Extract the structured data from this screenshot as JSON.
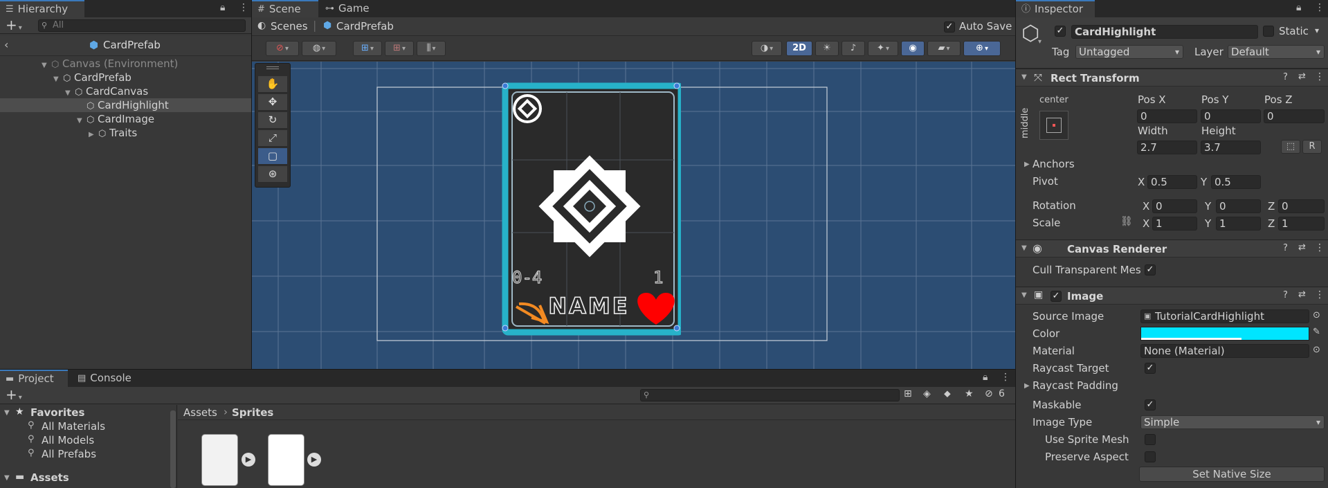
{
  "hierarchy": {
    "tab_label": "Hierarchy",
    "search_placeholder": "All",
    "prefab_title": "CardPrefab",
    "tree": [
      {
        "label": "Canvas (Environment)",
        "depth": 0,
        "expanded": true,
        "muted": true
      },
      {
        "label": "CardPrefab",
        "depth": 1,
        "expanded": true,
        "muted": false
      },
      {
        "label": "CardCanvas",
        "depth": 2,
        "expanded": true,
        "muted": false
      },
      {
        "label": "CardHighlight",
        "depth": 3,
        "expanded": null,
        "muted": false,
        "selected": true
      },
      {
        "label": "CardImage",
        "depth": 3,
        "expanded": true,
        "muted": false
      },
      {
        "label": "Traits",
        "depth": 4,
        "expanded": false,
        "muted": false
      }
    ]
  },
  "scene": {
    "tabs": [
      "Scene",
      "Game"
    ],
    "breadcrumb": [
      "Scenes",
      "CardPrefab"
    ],
    "auto_save_label": "Auto Save",
    "auto_save_checked": true,
    "mode_2d_label": "2D",
    "card": {
      "cost_text": "0-4",
      "power_text": "1",
      "name_text": "NAME"
    },
    "colors": {
      "background": "#2c4d73",
      "highlight": "#27b2c9",
      "card_body": "#2a2a2a",
      "heart": "#ff0000",
      "bow": "#f28a22"
    }
  },
  "inspector": {
    "tab_label": "Inspector",
    "object_name": "CardHighlight",
    "active_checked": true,
    "static_label": "Static",
    "tag_label": "Tag",
    "tag_value": "Untagged",
    "layer_label": "Layer",
    "layer_value": "Default",
    "rect_transform": {
      "title": "Rect Transform",
      "anchor_h": "center",
      "anchor_v": "middle",
      "pos_x_label": "Pos X",
      "pos_x": "0",
      "pos_y_label": "Pos Y",
      "pos_y": "0",
      "pos_z_label": "Pos Z",
      "pos_z": "0",
      "width_label": "Width",
      "width": "2.7",
      "height_label": "Height",
      "height": "3.7",
      "r_button": "R",
      "anchors_label": "Anchors",
      "pivot_label": "Pivot",
      "pivot_x": "0.5",
      "pivot_y": "0.5",
      "rotation_label": "Rotation",
      "rot_x": "0",
      "rot_y": "0",
      "rot_z": "0",
      "scale_label": "Scale",
      "scale_x": "1",
      "scale_y": "1",
      "scale_z": "1",
      "x": "X",
      "y": "Y",
      "z": "Z"
    },
    "canvas_renderer": {
      "title": "Canvas Renderer",
      "cull_label": "Cull Transparent Mes",
      "cull_checked": true
    },
    "image": {
      "title": "Image",
      "enabled": true,
      "source_image_label": "Source Image",
      "source_image_value": "TutorialCardHighlight",
      "color_label": "Color",
      "color_value": "#00e5ff",
      "material_label": "Material",
      "material_value": "None (Material)",
      "raycast_target_label": "Raycast Target",
      "raycast_target_checked": true,
      "raycast_padding_label": "Raycast Padding",
      "maskable_label": "Maskable",
      "maskable_checked": true,
      "image_type_label": "Image Type",
      "image_type_value": "Simple",
      "use_sprite_mesh_label": "Use Sprite Mesh",
      "preserve_aspect_label": "Preserve Aspect",
      "set_native_size_label": "Set Native Size"
    }
  },
  "project": {
    "tabs": [
      "Project",
      "Console"
    ],
    "favorites_label": "Favorites",
    "favorites": [
      "All Materials",
      "All Models",
      "All Prefabs"
    ],
    "assets_label": "Assets",
    "breadcrumb": [
      "Assets",
      "Sprites"
    ],
    "hidden_count": "6"
  }
}
